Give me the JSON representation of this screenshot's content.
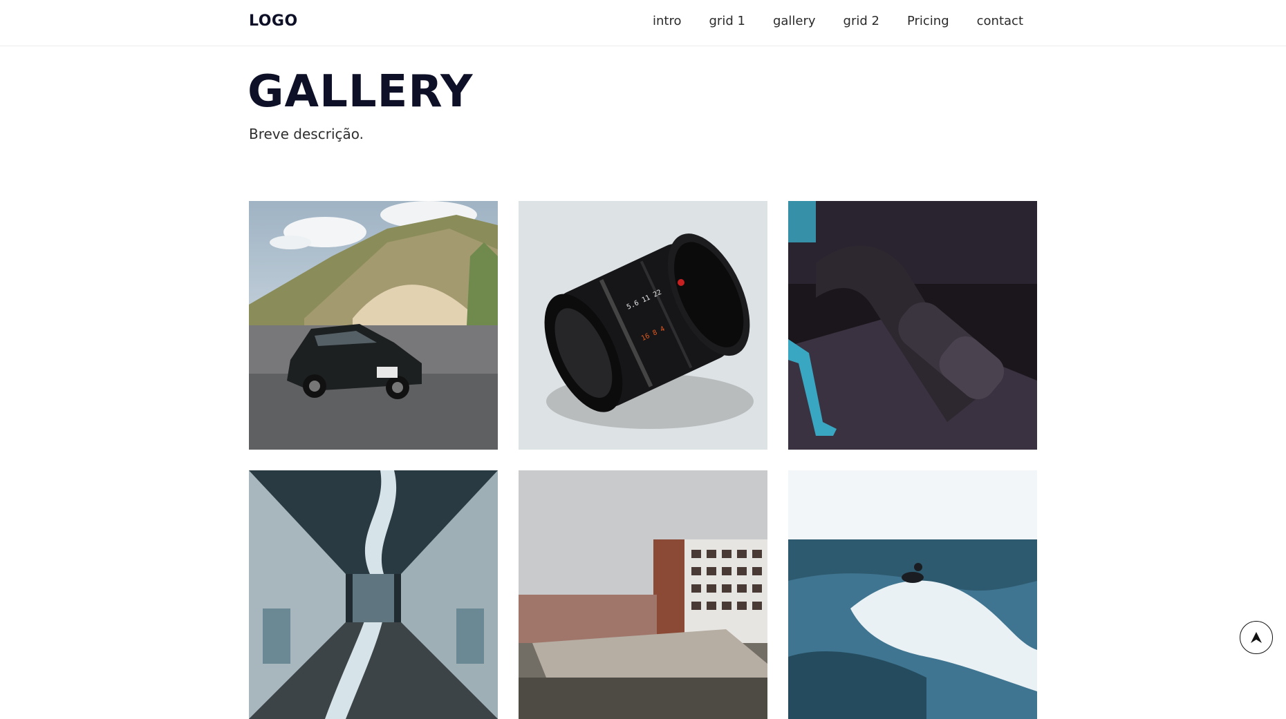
{
  "header": {
    "logo": "LOGO",
    "nav": [
      {
        "label": "intro"
      },
      {
        "label": "grid 1"
      },
      {
        "label": "gallery"
      },
      {
        "label": "grid 2"
      },
      {
        "label": "Pricing"
      },
      {
        "label": "contact"
      }
    ]
  },
  "section": {
    "title": "GALLERY",
    "description": "Breve descrição."
  },
  "gallery": {
    "images": [
      {
        "name": "car-photo"
      },
      {
        "name": "camera-lens-photo"
      },
      {
        "name": "motorcycle-handle-photo"
      },
      {
        "name": "tunnel-photo"
      },
      {
        "name": "building-photo"
      },
      {
        "name": "surfer-photo"
      }
    ]
  },
  "scroll_top": {
    "icon": "arrow-up-icon"
  }
}
